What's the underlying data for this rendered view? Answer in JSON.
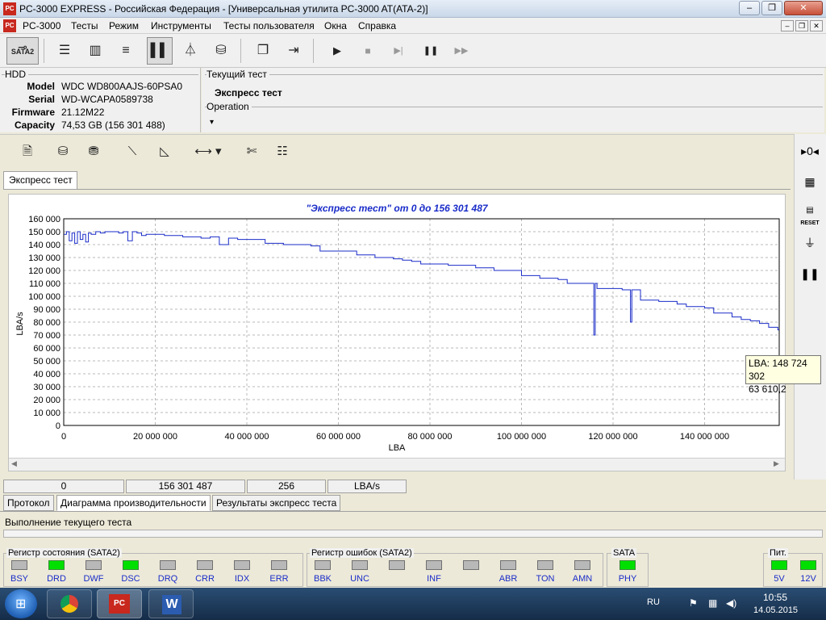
{
  "window": {
    "title": "PC-3000 EXPRESS - Российская Федерация - [Универсальная утилита PC-3000 AT(ATA-2)]",
    "icon_text": "PC",
    "minimize": "–",
    "restore": "❐",
    "close": "✕"
  },
  "menu": {
    "items": [
      "PC-3000",
      "Тесты",
      "Режим",
      "Инструменты",
      "Тесты пользователя",
      "Окна",
      "Справка"
    ],
    "mdi_minimize": "–",
    "mdi_restore": "❐",
    "mdi_close": "✕"
  },
  "toolbar": {
    "sata_label": "SATA2",
    "play": "▶",
    "stop": "■",
    "step": "▶|",
    "pause": "❚❚",
    "fast": "▶▶"
  },
  "hdd": {
    "group_label": "HDD",
    "model_label": "Model",
    "model": "WDC WD800AAJS-60PSA0",
    "serial_label": "Serial",
    "serial": "WD-WCAPA0589738",
    "firmware_label": "Firmware",
    "firmware": "21.12M22",
    "capacity_label": "Capacity",
    "capacity": "74,53 GB (156 301 488)"
  },
  "current_test": {
    "label": "Текущий тест",
    "value": "Экспресс тест",
    "operation_label": "Operation",
    "operation_arrow": "▾"
  },
  "chart_tab": "Экспресс тест",
  "chart_data": {
    "type": "line",
    "title": "\"Экспресс тест\" от 0 до 156 301 487",
    "xlabel": "LBA",
    "ylabel": "LBA/s",
    "xlim": [
      0,
      156301487
    ],
    "ylim": [
      0,
      160000
    ],
    "y_ticks": [
      "0",
      "10 000",
      "20 000",
      "30 000",
      "40 000",
      "50 000",
      "60 000",
      "70 000",
      "80 000",
      "90 000",
      "100 000",
      "110 000",
      "120 000",
      "130 000",
      "140 000",
      "150 000",
      "160 000"
    ],
    "x_ticks": [
      "0",
      "20 000 000",
      "40 000 000",
      "60 000 000",
      "80 000 000",
      "100 000 000",
      "120 000 000",
      "140 000 000"
    ],
    "grid": true,
    "color": "#1a2cc8",
    "series": [
      {
        "x": [
          0,
          600000,
          1200000,
          1800000,
          2400000,
          3000000,
          3600000,
          4200000,
          4800000,
          5400000,
          6000000,
          7000000,
          8000000,
          9000000,
          10000000,
          11000000,
          12000000,
          13000000,
          14000000,
          15000000,
          16000000,
          17000000,
          18000000,
          20000000,
          22000000,
          24000000,
          26000000,
          28000000,
          30000000,
          32000000,
          34000000,
          36000000,
          38000000,
          40000000,
          42000000,
          44000000,
          46000000,
          48000000,
          50000000,
          52000000,
          54000000,
          56000000,
          58000000,
          60000000,
          62000000,
          64000000,
          66000000,
          68000000,
          70000000,
          72000000,
          74000000,
          76000000,
          78000000,
          80000000,
          82000000,
          84000000,
          86000000,
          88000000,
          90000000,
          92000000,
          94000000,
          96000000,
          98000000,
          100000000,
          102000000,
          104000000,
          106000000,
          108000000,
          110000000,
          112000000,
          114000000,
          115500000,
          115800000,
          116100000,
          116500000,
          117000000,
          118000000,
          120000000,
          122000000,
          123500000,
          123800000,
          124100000,
          126000000,
          128000000,
          130000000,
          132000000,
          134000000,
          136000000,
          138000000,
          140000000,
          142000000,
          144000000,
          146000000,
          148000000,
          150000000,
          152000000,
          154000000,
          156000000
        ],
        "y": [
          148000,
          150000,
          143000,
          149000,
          141000,
          150000,
          144000,
          148000,
          142000,
          149000,
          148000,
          150000,
          149000,
          150000,
          150000,
          150000,
          149000,
          150000,
          143000,
          150000,
          149000,
          147000,
          148000,
          148000,
          147000,
          147000,
          146000,
          146000,
          145000,
          146000,
          140000,
          145000,
          144000,
          144000,
          144000,
          141000,
          141000,
          140000,
          140000,
          140000,
          139000,
          135000,
          135000,
          135000,
          135000,
          132000,
          132000,
          130000,
          130000,
          129000,
          128000,
          127000,
          125000,
          125000,
          125000,
          124000,
          124000,
          124000,
          122000,
          122000,
          120000,
          120000,
          120000,
          116000,
          116000,
          114000,
          114000,
          113000,
          110000,
          110000,
          110000,
          110000,
          70000,
          110000,
          106000,
          106000,
          106000,
          106000,
          105000,
          105000,
          80000,
          105000,
          97000,
          97000,
          96000,
          96000,
          94000,
          92000,
          92000,
          91000,
          87000,
          87000,
          84000,
          82000,
          81000,
          79000,
          76000,
          74000
        ]
      }
    ]
  },
  "tooltip": {
    "line1": "LBA: 148 724 302",
    "line2": "63 610,2"
  },
  "status": {
    "start": "0",
    "end": "156 301 487",
    "block": "256",
    "unit": "LBA/s"
  },
  "bottom_tabs": [
    "Протокол",
    "Диаграмма производительности",
    "Результаты экспресс теста"
  ],
  "progress_label": "Выполнение текущего теста",
  "registers": {
    "state_title": "Регистр состояния (SATA2)",
    "state": [
      {
        "name": "BSY",
        "on": false
      },
      {
        "name": "DRD",
        "on": true
      },
      {
        "name": "DWF",
        "on": false
      },
      {
        "name": "DSC",
        "on": true
      },
      {
        "name": "DRQ",
        "on": false
      },
      {
        "name": "CRR",
        "on": false
      },
      {
        "name": "IDX",
        "on": false
      },
      {
        "name": "ERR",
        "on": false
      }
    ],
    "error_title": "Регистр ошибок  (SATA2)",
    "errors": [
      {
        "name": "BBK",
        "on": false
      },
      {
        "name": "UNC",
        "on": false
      },
      {
        "name": "",
        "on": false
      },
      {
        "name": "INF",
        "on": false
      },
      {
        "name": "",
        "on": false
      },
      {
        "name": "ABR",
        "on": false
      },
      {
        "name": "TON",
        "on": false
      },
      {
        "name": "AMN",
        "on": false
      }
    ],
    "sata_title": "SATA",
    "sata": {
      "name": "PHY",
      "on": true
    },
    "power_title": "Пит.",
    "power": [
      {
        "name": "5V",
        "on": true
      },
      {
        "name": "12V",
        "on": true
      }
    ]
  },
  "side_icons": {
    "reset_label": "RESET"
  },
  "taskbar": {
    "lang": "RU",
    "time": "10:55",
    "date": "14.05.2015",
    "word_letter": "W"
  }
}
